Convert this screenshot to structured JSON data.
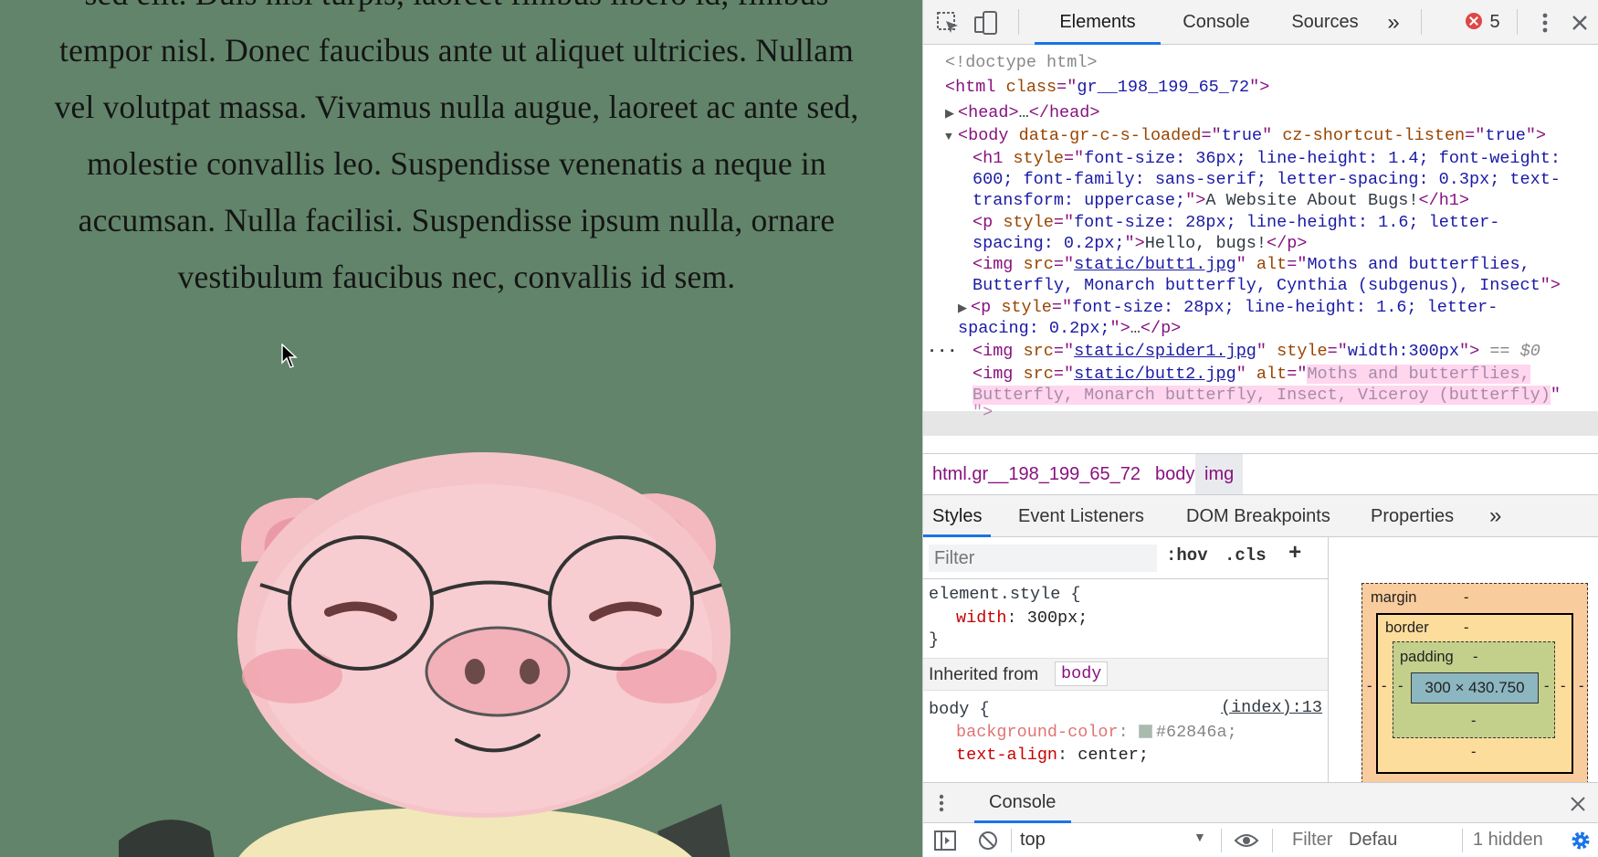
{
  "page": {
    "paragraph_lines": [
      "sed elit. Duis nisi turpis, laoreet finibus libero id, finibus",
      "tempor nisl. Donec faucibus ante ut aliquet ultricies. Nullam",
      "vel volutpat massa. Vivamus nulla augue, laoreet ac ante sed,",
      "molestie convallis leo. Suspendisse venenatis a neque in",
      "accumsan. Nulla facilisi. Suspendisse ipsum nulla, ornare",
      "vestibulum faucibus nec, convallis id sem."
    ],
    "background_color": "#62846a",
    "image_subject": "pink cartoon pig wearing round glasses"
  },
  "devtools": {
    "tabs": [
      "Elements",
      "Console",
      "Sources"
    ],
    "active_tab": "Elements",
    "more_tabs": "»",
    "error_count": "5",
    "dom": {
      "doctype": "<!doctype html>",
      "html_class": "gr__198_199_65_72",
      "head_collapsed": "…",
      "body_attr1_name": "data-gr-c-s-loaded",
      "body_attr1_value": "true",
      "body_attr2_name": "cz-shortcut-listen",
      "body_attr2_value": "true",
      "h1_style_line1": "font-size: 36px; line-height: 1.4; font-weight:",
      "h1_style_line2": "600; font-family: sans-serif; letter-spacing: 0.3px; text-",
      "h1_style_line3": "transform: uppercase;",
      "h1_text": "A Website About Bugs!",
      "p1_style_line1": "font-size: 28px; line-height: 1.6; letter-",
      "p1_style_line2": "spacing: 0.2px;",
      "p1_text": "Hello, bugs!",
      "img1_src": "static/butt1.jpg",
      "img1_alt_line1": "Moths and butterflies,",
      "img1_alt_line2": "Butterfly, Monarch butterfly, Cynthia (subgenus), Insect",
      "p2_style_line1": "font-size: 28px; line-height: 1.6; letter-",
      "p2_style_line2": "spacing: 0.2px;",
      "p2_collapsed": "…",
      "img2_src": "static/spider1.jpg",
      "img2_style": "width:300px",
      "selected_marker": "== $0",
      "img3_src": "static/butt2.jpg",
      "img3_alt_line1": "Moths and butterflies,",
      "img3_alt_line2": "Butterfly, Monarch butterfly, Insect, Viceroy (butterfly)"
    },
    "breadcrumbs": [
      "html.gr__198_199_65_72",
      "body",
      "img"
    ],
    "style_tabs": [
      "Styles",
      "Event Listeners",
      "DOM Breakpoints",
      "Properties"
    ],
    "styles": {
      "filter_placeholder": "Filter",
      "hov": ":hov",
      "cls": ".cls",
      "add": "+",
      "element_selector": "element.style {",
      "element_prop": "width",
      "element_value": "300px;",
      "close_brace": "}",
      "inherited_label": "Inherited from",
      "inherited_tag": "body",
      "body_selector": "body {",
      "source_link": "(index):13",
      "bg_prop": "background-color",
      "bg_value": "#62846a;",
      "bg_swatch_color": "#62846a",
      "ta_prop": "text-align",
      "ta_value": "center;"
    },
    "box_model": {
      "margin_label": "margin",
      "border_label": "border",
      "padding_label": "padding",
      "dash": "-",
      "content_size": "300 × 430.750"
    },
    "drawer": {
      "title": "Console",
      "context": "top",
      "filter": "Filter",
      "levels": "Defau",
      "hidden": "1 hidden"
    },
    "accent_color": "#1a73e8",
    "tag_color": "#881280",
    "attr_name_color": "#994500",
    "attr_value_color": "#1a1aa6"
  }
}
